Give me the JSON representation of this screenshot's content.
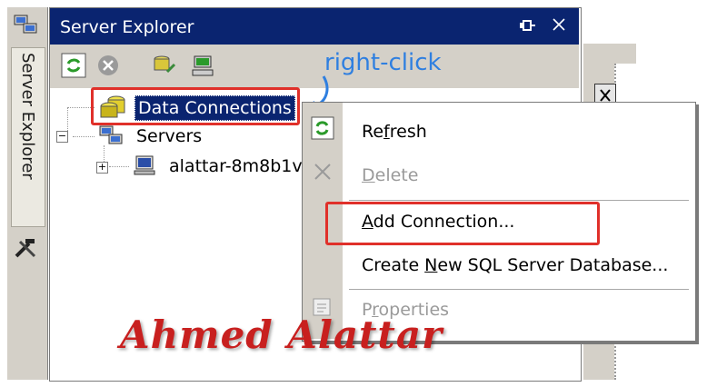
{
  "window": {
    "title": "Server Explorer",
    "dock_tab_label": "Server Explorer"
  },
  "tree": {
    "items": [
      {
        "label": "Data Connections"
      },
      {
        "label": "Servers"
      },
      {
        "label": "alattar-8m8b1v"
      }
    ]
  },
  "context_menu": {
    "items": [
      {
        "label_before": "Re",
        "accesskey": "f",
        "label_after": "resh",
        "enabled": true
      },
      {
        "label_before": "",
        "accesskey": "D",
        "label_after": "elete",
        "enabled": false
      },
      {
        "label_before": "",
        "accesskey": "A",
        "label_after": "dd Connection...",
        "enabled": true
      },
      {
        "label_before": "Create ",
        "accesskey": "N",
        "label_after": "ew SQL Server Database...",
        "enabled": true
      },
      {
        "label_before": "P",
        "accesskey": "r",
        "label_after": "operties",
        "enabled": false
      }
    ]
  },
  "annotation": {
    "text": "right-click"
  },
  "watermark": {
    "text": "Ahmed Alattar"
  },
  "colors": {
    "titlebar": "#0a2470",
    "highlight": "#e0302a",
    "annotation": "#2f7fe0"
  },
  "icons": [
    "server-explorer-dock-icon",
    "tools-icon",
    "refresh-icon",
    "stop-icon",
    "connect-database-icon",
    "connect-server-icon",
    "pin-icon",
    "close-icon",
    "database-icon",
    "servers-icon",
    "computer-icon",
    "delete-icon",
    "properties-icon"
  ]
}
